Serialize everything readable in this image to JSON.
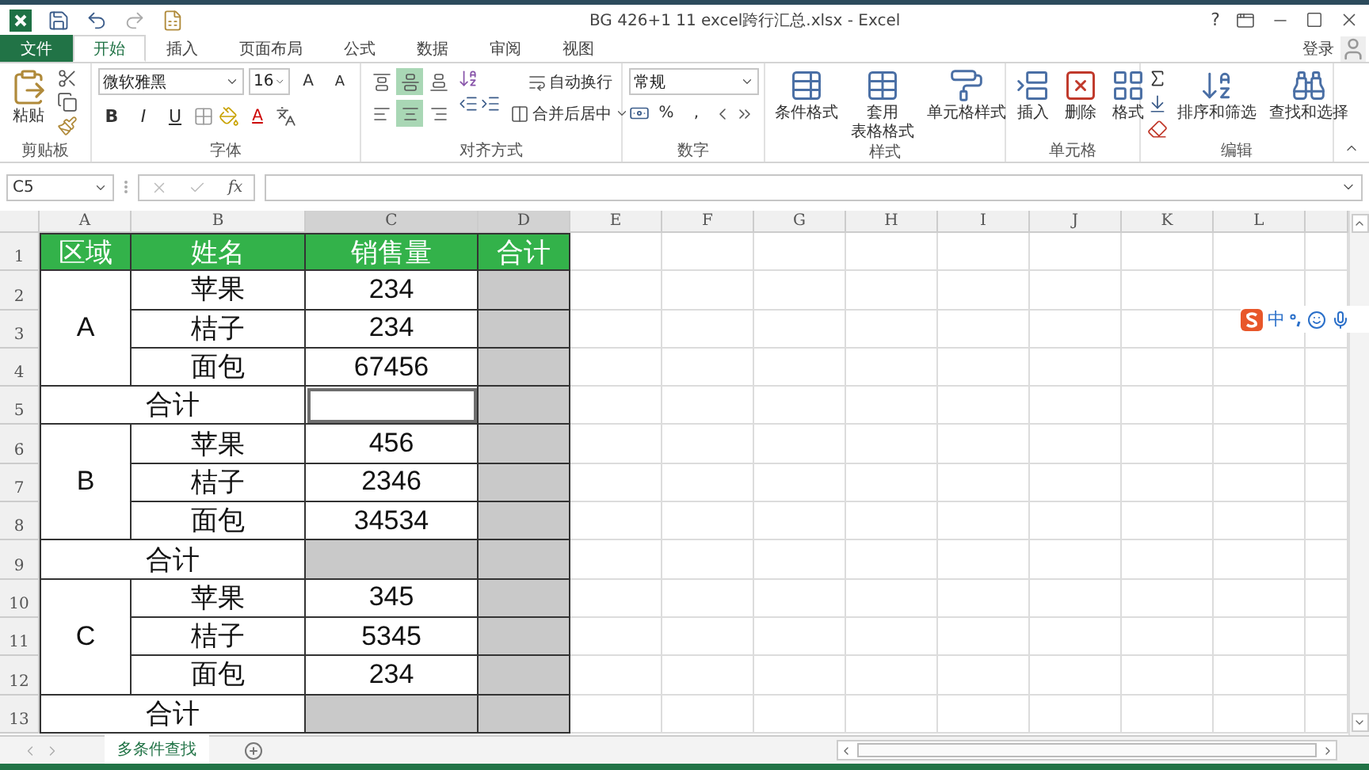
{
  "window": {
    "title": "BG 426+1 11 excel跨行汇总.xlsx - Excel",
    "help": "?"
  },
  "account": {
    "label": "登录"
  },
  "tabs": [
    {
      "label": "文件",
      "kind": "file",
      "selected": false
    },
    {
      "label": "开始",
      "kind": "tab",
      "selected": true
    },
    {
      "label": "插入",
      "kind": "tab",
      "selected": false
    },
    {
      "label": "页面布局",
      "kind": "tab",
      "selected": false
    },
    {
      "label": "公式",
      "kind": "tab",
      "selected": false
    },
    {
      "label": "数据",
      "kind": "tab",
      "selected": false
    },
    {
      "label": "审阅",
      "kind": "tab",
      "selected": false
    },
    {
      "label": "视图",
      "kind": "tab",
      "selected": false
    }
  ],
  "ribbon": {
    "clipboard": {
      "label": "剪贴板",
      "paste": "粘贴"
    },
    "font": {
      "label": "字体",
      "family": "微软雅黑",
      "size": "16",
      "grow": "A",
      "shrink": "A",
      "bold": "B",
      "italic": "I",
      "underline": "U",
      "color_letter": "A"
    },
    "alignment": {
      "label": "对齐方式",
      "wrap": "自动换行",
      "merge": "合并后居中",
      "vertical": [
        {
          "selected": false
        },
        {
          "selected": true
        },
        {
          "selected": false
        }
      ],
      "horizontal": [
        {
          "selected": false
        },
        {
          "selected": true
        },
        {
          "selected": false
        }
      ]
    },
    "number": {
      "label": "数字",
      "format": "常规",
      "percent": "%",
      "comma": ","
    },
    "styles": {
      "label": "样式",
      "buttons": [
        {
          "lines": [
            "条件格式"
          ]
        },
        {
          "lines": [
            "套用",
            "表格格式"
          ]
        },
        {
          "lines": [
            "单元格样式"
          ]
        }
      ]
    },
    "cells": {
      "label": "单元格",
      "buttons": [
        "插入",
        "删除",
        "格式"
      ]
    },
    "editing": {
      "label": "编辑",
      "buttons": [
        "排序和筛选",
        "查找和选择"
      ]
    }
  },
  "formula_bar": {
    "name_box": "C5",
    "fx": "fx"
  },
  "sheet": {
    "columns": [
      {
        "letter": "A",
        "highlighted": false
      },
      {
        "letter": "B",
        "highlighted": false
      },
      {
        "letter": "C",
        "highlighted": true
      },
      {
        "letter": "D",
        "highlighted": true
      },
      {
        "letter": "E",
        "highlighted": false
      },
      {
        "letter": "F",
        "highlighted": false
      },
      {
        "letter": "G",
        "highlighted": false
      },
      {
        "letter": "H",
        "highlighted": false
      },
      {
        "letter": "I",
        "highlighted": false
      },
      {
        "letter": "J",
        "highlighted": false
      },
      {
        "letter": "K",
        "highlighted": false
      },
      {
        "letter": "L",
        "highlighted": false
      }
    ],
    "rows": [
      "1",
      "2",
      "3",
      "4",
      "5",
      "6",
      "7",
      "8",
      "9",
      "10",
      "11",
      "12",
      "13"
    ],
    "header": [
      "区域",
      "姓名",
      "销售量",
      "合计"
    ],
    "groups": [
      {
        "region": "A",
        "items": [
          {
            "name": "苹果",
            "sales": "234",
            "total_shaded": true
          },
          {
            "name": "桔子",
            "sales": "234",
            "total_shaded": true
          },
          {
            "name": "面包",
            "sales": "67456",
            "total_shaded": true
          }
        ],
        "subtotal": {
          "label": "合计",
          "sales_shaded": false,
          "selected": true,
          "total_shaded": true
        }
      },
      {
        "region": "B",
        "items": [
          {
            "name": "苹果",
            "sales": "456",
            "total_shaded": true
          },
          {
            "name": "桔子",
            "sales": "2346",
            "total_shaded": true
          },
          {
            "name": "面包",
            "sales": "34534",
            "total_shaded": true
          }
        ],
        "subtotal": {
          "label": "合计",
          "sales_shaded": true,
          "selected": false,
          "total_shaded": true
        }
      },
      {
        "region": "C",
        "items": [
          {
            "name": "苹果",
            "sales": "345",
            "total_shaded": true
          },
          {
            "name": "桔子",
            "sales": "5345",
            "total_shaded": true
          },
          {
            "name": "面包",
            "sales": "234",
            "total_shaded": true
          }
        ],
        "subtotal": {
          "label": "合计",
          "sales_shaded": true,
          "selected": false,
          "total_shaded": true
        }
      }
    ]
  },
  "sheet_tabs": [
    {
      "label": "多条件查找",
      "selected": true
    }
  ],
  "ime_bar": {
    "mode": "中"
  }
}
